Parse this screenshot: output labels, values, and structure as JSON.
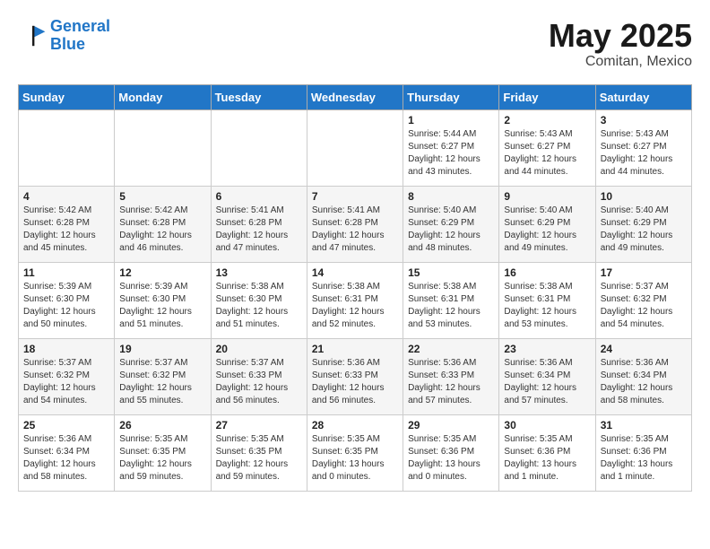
{
  "logo": {
    "line1": "General",
    "line2": "Blue"
  },
  "title": "May 2025",
  "location": "Comitan, Mexico",
  "days_header": [
    "Sunday",
    "Monday",
    "Tuesday",
    "Wednesday",
    "Thursday",
    "Friday",
    "Saturday"
  ],
  "weeks": [
    [
      {
        "day": "",
        "info": ""
      },
      {
        "day": "",
        "info": ""
      },
      {
        "day": "",
        "info": ""
      },
      {
        "day": "",
        "info": ""
      },
      {
        "day": "1",
        "info": "Sunrise: 5:44 AM\nSunset: 6:27 PM\nDaylight: 12 hours\nand 43 minutes."
      },
      {
        "day": "2",
        "info": "Sunrise: 5:43 AM\nSunset: 6:27 PM\nDaylight: 12 hours\nand 44 minutes."
      },
      {
        "day": "3",
        "info": "Sunrise: 5:43 AM\nSunset: 6:27 PM\nDaylight: 12 hours\nand 44 minutes."
      }
    ],
    [
      {
        "day": "4",
        "info": "Sunrise: 5:42 AM\nSunset: 6:28 PM\nDaylight: 12 hours\nand 45 minutes."
      },
      {
        "day": "5",
        "info": "Sunrise: 5:42 AM\nSunset: 6:28 PM\nDaylight: 12 hours\nand 46 minutes."
      },
      {
        "day": "6",
        "info": "Sunrise: 5:41 AM\nSunset: 6:28 PM\nDaylight: 12 hours\nand 47 minutes."
      },
      {
        "day": "7",
        "info": "Sunrise: 5:41 AM\nSunset: 6:28 PM\nDaylight: 12 hours\nand 47 minutes."
      },
      {
        "day": "8",
        "info": "Sunrise: 5:40 AM\nSunset: 6:29 PM\nDaylight: 12 hours\nand 48 minutes."
      },
      {
        "day": "9",
        "info": "Sunrise: 5:40 AM\nSunset: 6:29 PM\nDaylight: 12 hours\nand 49 minutes."
      },
      {
        "day": "10",
        "info": "Sunrise: 5:40 AM\nSunset: 6:29 PM\nDaylight: 12 hours\nand 49 minutes."
      }
    ],
    [
      {
        "day": "11",
        "info": "Sunrise: 5:39 AM\nSunset: 6:30 PM\nDaylight: 12 hours\nand 50 minutes."
      },
      {
        "day": "12",
        "info": "Sunrise: 5:39 AM\nSunset: 6:30 PM\nDaylight: 12 hours\nand 51 minutes."
      },
      {
        "day": "13",
        "info": "Sunrise: 5:38 AM\nSunset: 6:30 PM\nDaylight: 12 hours\nand 51 minutes."
      },
      {
        "day": "14",
        "info": "Sunrise: 5:38 AM\nSunset: 6:31 PM\nDaylight: 12 hours\nand 52 minutes."
      },
      {
        "day": "15",
        "info": "Sunrise: 5:38 AM\nSunset: 6:31 PM\nDaylight: 12 hours\nand 53 minutes."
      },
      {
        "day": "16",
        "info": "Sunrise: 5:38 AM\nSunset: 6:31 PM\nDaylight: 12 hours\nand 53 minutes."
      },
      {
        "day": "17",
        "info": "Sunrise: 5:37 AM\nSunset: 6:32 PM\nDaylight: 12 hours\nand 54 minutes."
      }
    ],
    [
      {
        "day": "18",
        "info": "Sunrise: 5:37 AM\nSunset: 6:32 PM\nDaylight: 12 hours\nand 54 minutes."
      },
      {
        "day": "19",
        "info": "Sunrise: 5:37 AM\nSunset: 6:32 PM\nDaylight: 12 hours\nand 55 minutes."
      },
      {
        "day": "20",
        "info": "Sunrise: 5:37 AM\nSunset: 6:33 PM\nDaylight: 12 hours\nand 56 minutes."
      },
      {
        "day": "21",
        "info": "Sunrise: 5:36 AM\nSunset: 6:33 PM\nDaylight: 12 hours\nand 56 minutes."
      },
      {
        "day": "22",
        "info": "Sunrise: 5:36 AM\nSunset: 6:33 PM\nDaylight: 12 hours\nand 57 minutes."
      },
      {
        "day": "23",
        "info": "Sunrise: 5:36 AM\nSunset: 6:34 PM\nDaylight: 12 hours\nand 57 minutes."
      },
      {
        "day": "24",
        "info": "Sunrise: 5:36 AM\nSunset: 6:34 PM\nDaylight: 12 hours\nand 58 minutes."
      }
    ],
    [
      {
        "day": "25",
        "info": "Sunrise: 5:36 AM\nSunset: 6:34 PM\nDaylight: 12 hours\nand 58 minutes."
      },
      {
        "day": "26",
        "info": "Sunrise: 5:35 AM\nSunset: 6:35 PM\nDaylight: 12 hours\nand 59 minutes."
      },
      {
        "day": "27",
        "info": "Sunrise: 5:35 AM\nSunset: 6:35 PM\nDaylight: 12 hours\nand 59 minutes."
      },
      {
        "day": "28",
        "info": "Sunrise: 5:35 AM\nSunset: 6:35 PM\nDaylight: 13 hours\nand 0 minutes."
      },
      {
        "day": "29",
        "info": "Sunrise: 5:35 AM\nSunset: 6:36 PM\nDaylight: 13 hours\nand 0 minutes."
      },
      {
        "day": "30",
        "info": "Sunrise: 5:35 AM\nSunset: 6:36 PM\nDaylight: 13 hours\nand 1 minute."
      },
      {
        "day": "31",
        "info": "Sunrise: 5:35 AM\nSunset: 6:36 PM\nDaylight: 13 hours\nand 1 minute."
      }
    ]
  ]
}
